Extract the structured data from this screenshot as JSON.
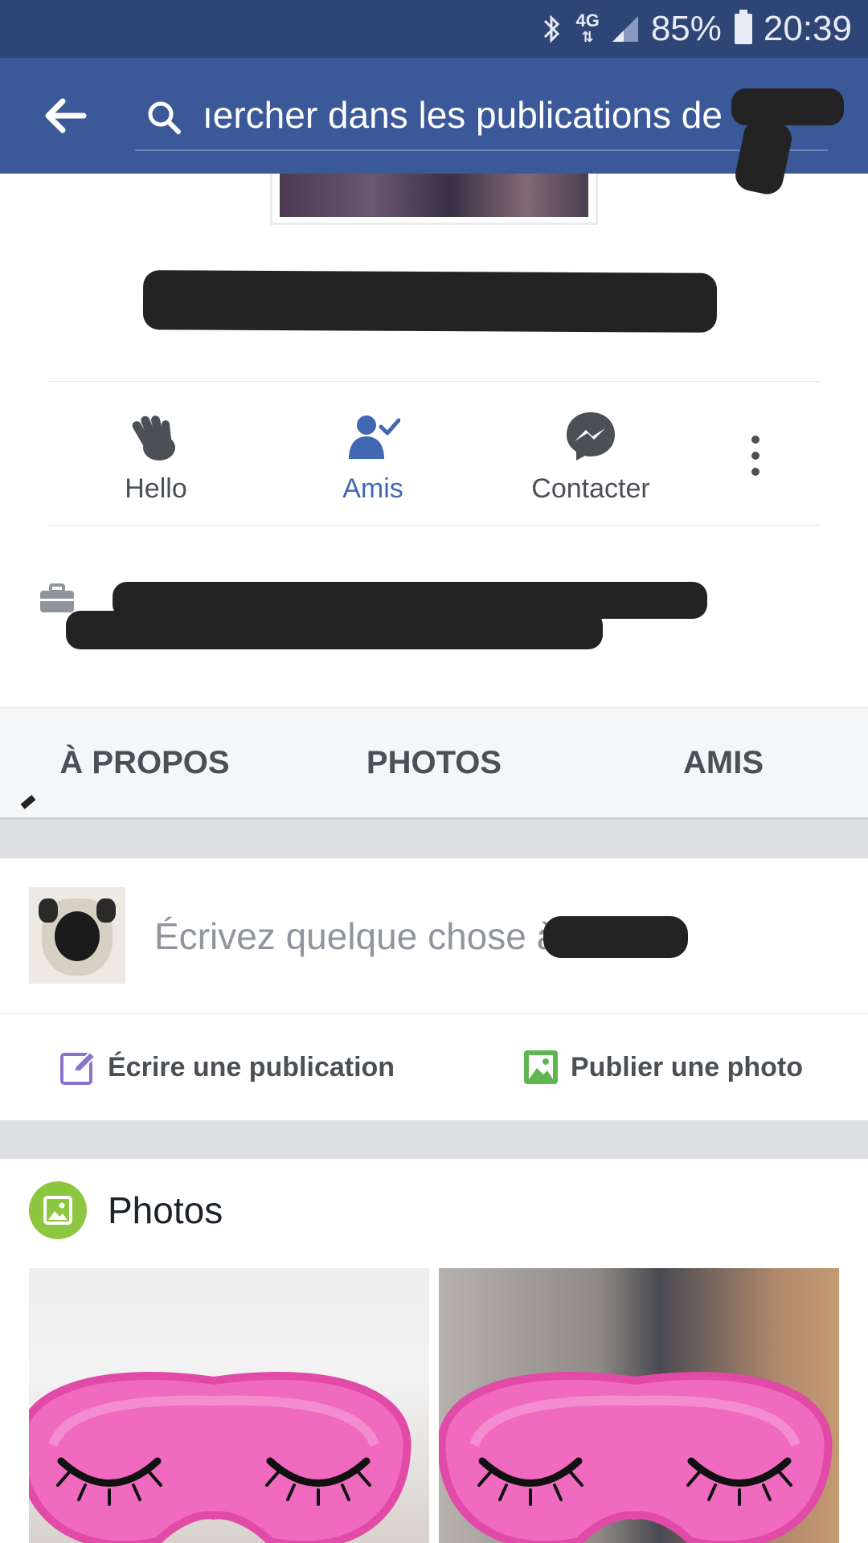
{
  "status_bar": {
    "bluetooth_icon": "bluetooth-icon",
    "network": "4G",
    "battery": "85%",
    "time": "20:39"
  },
  "app_bar": {
    "back_icon": "arrow-left-icon",
    "search_icon": "search-icon",
    "search_placeholder": "ıercher dans les publications de"
  },
  "profile": {
    "actions": [
      {
        "label": "Hello",
        "icon": "wave-hand-icon",
        "active": false
      },
      {
        "label": "Amis",
        "icon": "friend-check-icon",
        "active": true
      },
      {
        "label": "Contacter",
        "icon": "messenger-icon",
        "active": false
      }
    ],
    "more_icon": "more-vertical-icon",
    "work_icon": "briefcase-icon"
  },
  "tabs": [
    "À PROPOS",
    "PHOTOS",
    "AMIS"
  ],
  "composer": {
    "placeholder": "Écrivez quelque chose à",
    "write_post": "Écrire une publication",
    "post_photo": "Publier une photo"
  },
  "photos": {
    "title": "Photos"
  },
  "colors": {
    "status_bar": "#2f4576",
    "app_bar": "#3b5998",
    "active_blue": "#4267b2",
    "photos_green": "#8dc63f",
    "write_purple": "#8c72cb",
    "photo_green": "#5fb650"
  }
}
